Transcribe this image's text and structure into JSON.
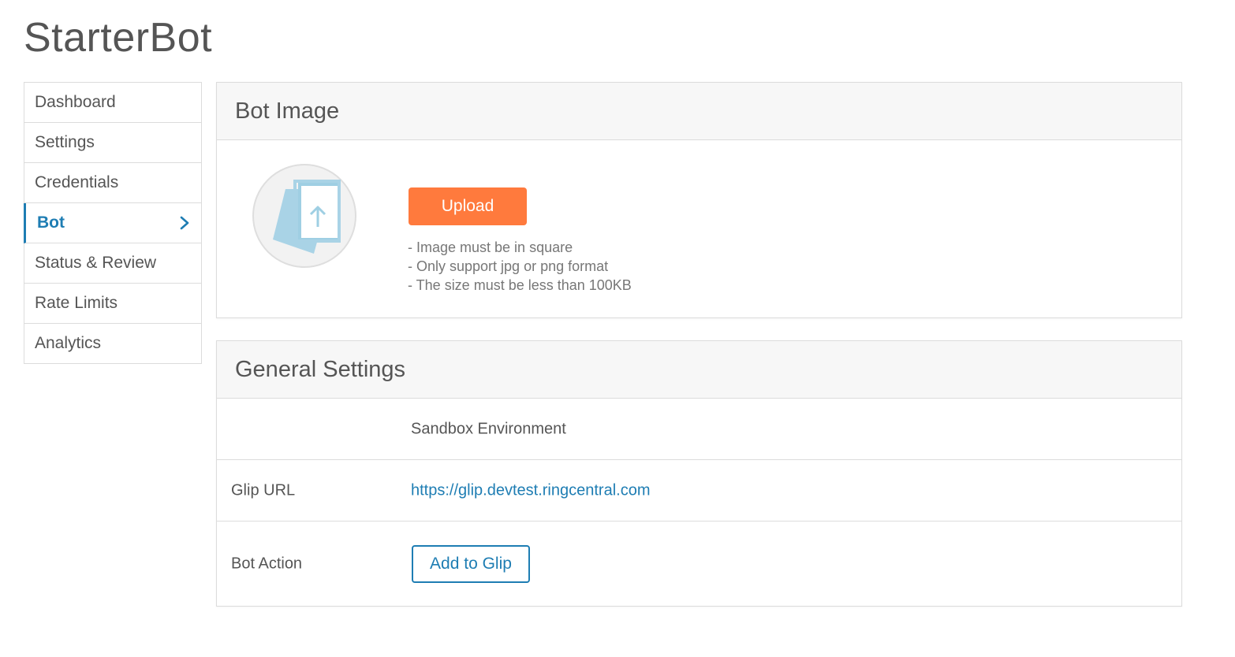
{
  "app": {
    "title": "StarterBot"
  },
  "sidebar": {
    "items": [
      {
        "label": "Dashboard"
      },
      {
        "label": "Settings"
      },
      {
        "label": "Credentials"
      },
      {
        "label": "Bot",
        "active": true,
        "icon": "chevron-right-icon"
      },
      {
        "label": "Status & Review"
      },
      {
        "label": "Rate Limits"
      },
      {
        "label": "Analytics"
      }
    ]
  },
  "bot_image": {
    "title": "Bot Image",
    "placeholder_icon": "image-upload-icon",
    "upload_label": "Upload",
    "hints": [
      "- Image must be in square",
      "- Only support jpg or png format",
      "- The size must be less than 100KB"
    ]
  },
  "general_settings": {
    "title": "General Settings",
    "environment": "Sandbox Environment",
    "glip_url_label": "Glip URL",
    "glip_url_value": "https://glip.devtest.ringcentral.com",
    "bot_action_label": "Bot Action",
    "add_to_glip_label": "Add to Glip"
  },
  "colors": {
    "accent": "#1e7db3",
    "upload_button": "#ff7a3d",
    "border": "#dcdcdc",
    "header_bg": "#f7f7f7"
  }
}
